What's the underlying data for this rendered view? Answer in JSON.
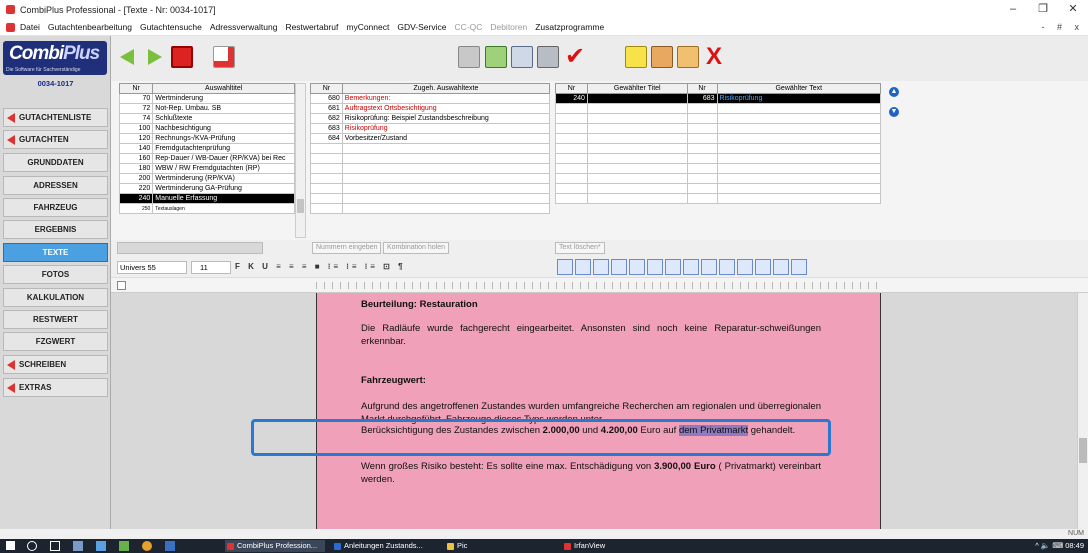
{
  "window": {
    "title": "CombiPlus Professional - [Texte - Nr: 0034-1017]",
    "controls": [
      "–",
      "❐",
      "✕"
    ]
  },
  "menu": [
    "Datei",
    "Gutachtenbearbeitung",
    "Gutachtensuche",
    "Adressverwaltung",
    "Restwertabruf",
    "myConnect",
    "GDV-Service",
    "CC-QC",
    "Debitoren",
    "Zusatzprogramme"
  ],
  "menu_disabled": [
    "CC-QC",
    "Debitoren"
  ],
  "mdi_controls": "- # x",
  "logo": {
    "main": "Combi",
    "plus": "Plus",
    "sub": "Die Software für Sachverständige"
  },
  "sidebar": {
    "doc_no": "0034-1017",
    "items": [
      "GUTACHTENLISTE",
      "GUTACHTEN",
      "GRUNDDATEN",
      "ADRESSEN",
      "FAHRZEUG",
      "ERGEBNIS",
      "TEXTE",
      "FOTOS",
      "KALKULATION",
      "RESTWERT",
      "FZGWERT",
      "SCHREIBEN",
      "EXTRAS"
    ]
  },
  "table1": {
    "headers": [
      "Nr",
      "Auswahltitel"
    ],
    "rows": [
      {
        "nr": "70",
        "text": "Wertminderung"
      },
      {
        "nr": "72",
        "text": "Not-Rep. Umbau. SB"
      },
      {
        "nr": "74",
        "text": "Schlußtexte"
      },
      {
        "nr": "100",
        "text": "Nachbesichtigung"
      },
      {
        "nr": "120",
        "text": "Rechnungs-/KVA-Prüfung"
      },
      {
        "nr": "140",
        "text": "Fremdgutachtenprüfung"
      },
      {
        "nr": "160",
        "text": "Rep-Dauer / WB-Dauer (RP/KVA) bei Rec"
      },
      {
        "nr": "180",
        "text": "WBW / RW Fremdgutachten (RP)"
      },
      {
        "nr": "200",
        "text": "Wertminderung (RP/KVA)"
      },
      {
        "nr": "220",
        "text": "Wertminderung GA-Prüfung"
      },
      {
        "nr": "240",
        "text": "Manuelle Erfassung"
      },
      {
        "nr": "250",
        "text": "Textauslagen"
      }
    ]
  },
  "table2": {
    "headers": [
      "Nr",
      "Zugeh. Auswahltexte"
    ],
    "rows": [
      {
        "nr": "680",
        "text": "Bemerkungen:"
      },
      {
        "nr": "681",
        "text": "Auftragstext Ortsbesichtigung"
      },
      {
        "nr": "682",
        "text": "Risikoprüfung: Beispiel Zustandsbeschreibung"
      },
      {
        "nr": "683",
        "text": "Risikoprüfung"
      },
      {
        "nr": "684",
        "text": "Vorbesitzer/Zustand"
      }
    ]
  },
  "table3": {
    "headers": [
      "Nr",
      "Gewählter Titel",
      "Nr",
      "Gewählter Text"
    ],
    "rows": [
      {
        "nr1": "240",
        "title": "",
        "nr2": "683",
        "text": "Risikoprüfung"
      }
    ]
  },
  "actions": {
    "number_input": "Nummern eingeben",
    "combine": "Kombination holen",
    "delete_text": "Text löschen*"
  },
  "format": {
    "font": "Univers 55",
    "size": "11",
    "glyphs": "F K U  ≡ ≡ ≡ ■  ⁝≡ ⁝≡ ⁝≡  ⊡ ¶"
  },
  "document": {
    "heading1": "Beurteilung: Restauration",
    "para1": "Die Radläufe wurde fachgerecht eingearbeitet. Ansonsten sind noch keine Reparatur-schweißungen erkennbar.",
    "heading2": "Fahrzeugwert:",
    "para2": "Aufgrund des angetroffenen Zustandes wurden umfangreiche Recherchen am regionalen und überregionalen Markt durchgeführt. Fahrzeuge dieses Typs werden unter",
    "para3": {
      "pre": "Berücksichtigung des Zustandes zwischen ",
      "v1": "2.000,00",
      "mid": " und ",
      "v2": "4.200,00",
      "mid2": " Euro auf ",
      "hl": "dem Privatmarkt",
      "post": " gehandelt."
    },
    "para4": {
      "pre": "Wenn großes Risiko besteht: Es sollte eine max. Entschädigung von ",
      "v": "3.900,00 Euro",
      "post": " ( Privatmarkt) vereinbart werden."
    }
  },
  "status": {
    "num": "NUM"
  },
  "taskbar": {
    "tasks": [
      "CombiPlus Profession...",
      "Anleitungen Zustands...",
      "Pic",
      "IrfanView"
    ],
    "tray": "^ 🔈 ⌨ 08:49"
  },
  "colors": {
    "accent": "#4aa0e0",
    "page": "#f0a0b8",
    "callout": "#2a78d0",
    "red_text": "#c00000"
  }
}
